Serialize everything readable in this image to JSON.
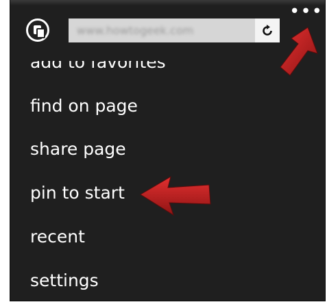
{
  "browser": {
    "url": "www.howtogeek.com",
    "more_glyph": "•••"
  },
  "menu": {
    "items": [
      {
        "label": "add to favorites"
      },
      {
        "label": "find on page"
      },
      {
        "label": "share page"
      },
      {
        "label": "pin to start"
      },
      {
        "label": "recent"
      },
      {
        "label": "settings"
      }
    ]
  },
  "colors": {
    "background": "#1f1f1f",
    "text": "#ffffff",
    "address_bar": "#d6d6d6",
    "arrow": "#cc1f1f"
  },
  "icons": {
    "tabs": "tabs-icon",
    "refresh": "refresh-icon",
    "more": "more-icon",
    "annotation": "red-arrow-icon"
  }
}
